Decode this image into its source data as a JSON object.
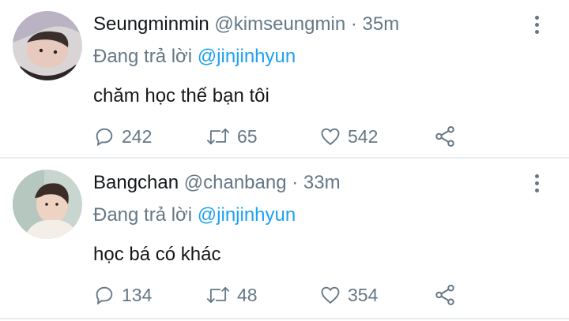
{
  "tweets": [
    {
      "display_name": "Seungminmin",
      "handle": "@kimseungmin",
      "separator": "·",
      "time": "35m",
      "replying_prefix": "Đang trả lời",
      "replying_to": "@jinjinhyun",
      "text": "chăm học thế bạn tôi",
      "replies": "242",
      "retweets": "65",
      "likes": "542"
    },
    {
      "display_name": "Bangchan",
      "handle": "@chanbang",
      "separator": "·",
      "time": "33m",
      "replying_prefix": "Đang trả lời",
      "replying_to": "@jinjinhyun",
      "text": "học bá có khác",
      "replies": "134",
      "retweets": "48",
      "likes": "354"
    }
  ],
  "icons": {
    "reply": "reply-icon",
    "retweet": "retweet-icon",
    "like": "heart-icon",
    "share": "share-icon",
    "more": "more-vertical-icon"
  },
  "colors": {
    "mention": "#1da1f2",
    "muted": "#657786",
    "text": "#14171a",
    "divider": "#e6ecf0"
  }
}
